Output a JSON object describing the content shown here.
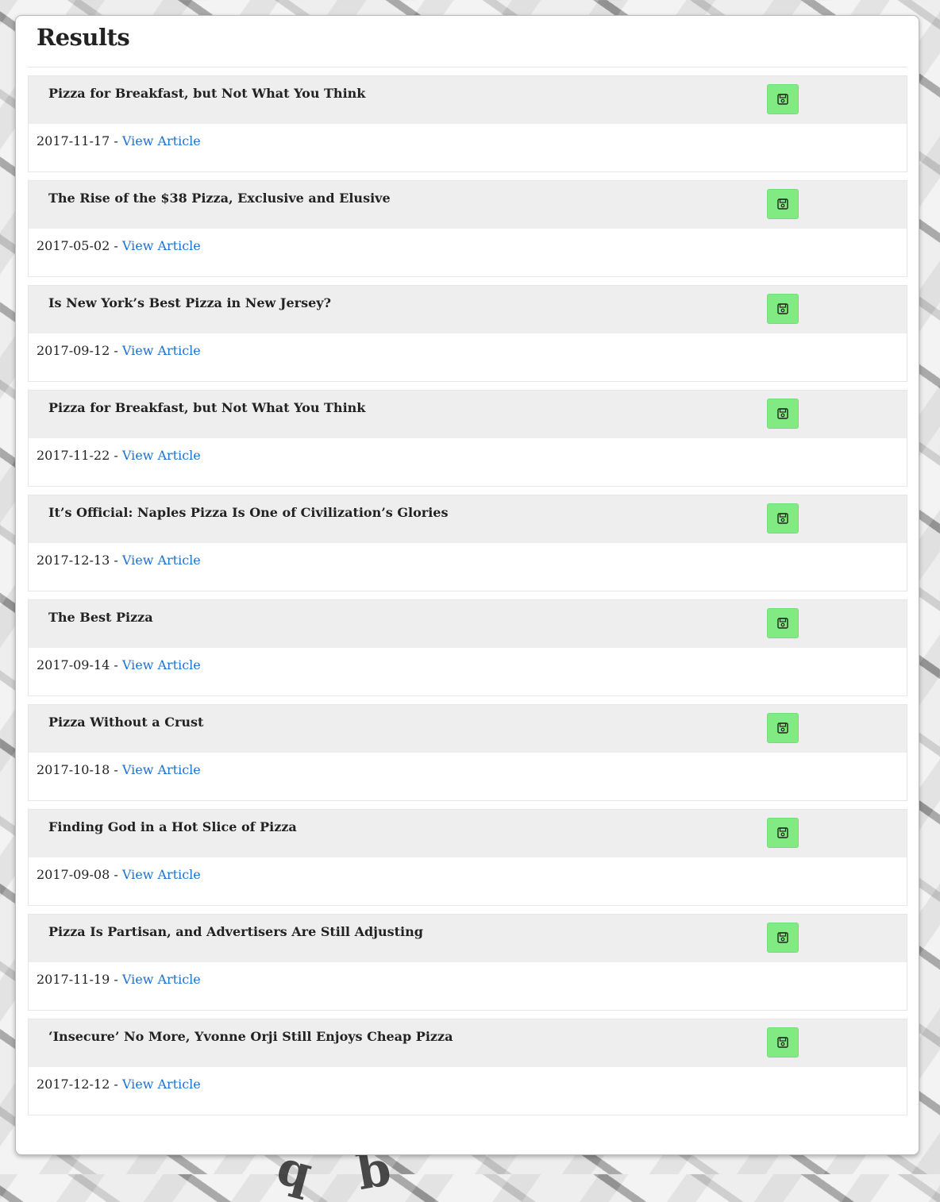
{
  "heading": "Results",
  "save_icon": "floppy-disk-icon",
  "colors": {
    "save_button": "#82ea82",
    "link": "#1b73d3",
    "card_header": "#eeeeee"
  },
  "results": [
    {
      "title": "Pizza for Breakfast, but Not What You Think",
      "date": "2017-11-17",
      "separator": " - ",
      "link_label": "View Article"
    },
    {
      "title": "The Rise of the $38 Pizza, Exclusive and Elusive",
      "date": "2017-05-02",
      "separator": " - ",
      "link_label": "View Article"
    },
    {
      "title": "Is New York’s Best Pizza in New Jersey?",
      "date": "2017-09-12",
      "separator": " - ",
      "link_label": "View Article"
    },
    {
      "title": "Pizza for Breakfast, but Not What You Think",
      "date": "2017-11-22",
      "separator": " - ",
      "link_label": "View Article"
    },
    {
      "title": "It’s Official: Naples Pizza Is One of Civilization’s Glories",
      "date": "2017-12-13",
      "separator": " - ",
      "link_label": "View Article"
    },
    {
      "title": "The Best Pizza",
      "date": "2017-09-14",
      "separator": " - ",
      "link_label": "View Article"
    },
    {
      "title": "Pizza Without a Crust",
      "date": "2017-10-18",
      "separator": " - ",
      "link_label": "View Article"
    },
    {
      "title": "Finding God in a Hot Slice of Pizza",
      "date": "2017-09-08",
      "separator": " - ",
      "link_label": "View Article"
    },
    {
      "title": "Pizza Is Partisan, and Advertisers Are Still Adjusting",
      "date": "2017-11-19",
      "separator": " - ",
      "link_label": "View Article"
    },
    {
      "title": "‘Insecure’ No More, Yvonne Orji Still Enjoys Cheap Pizza",
      "date": "2017-12-12",
      "separator": " - ",
      "link_label": "View Article"
    }
  ]
}
